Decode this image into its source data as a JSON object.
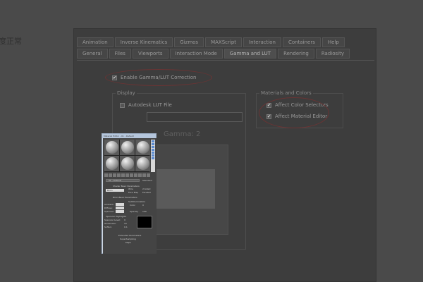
{
  "page": {
    "side_text": "度正常"
  },
  "dialog": {
    "tabs_row1": [
      "Animation",
      "Inverse Kinematics",
      "Gizmos",
      "MAXScript",
      "Interaction",
      "Containers",
      "Help"
    ],
    "tabs_row2": [
      "General",
      "Files",
      "Viewports",
      "Interaction Mode",
      "Gamma and LUT",
      "Rendering",
      "Radiosity"
    ],
    "active_tab": "Gamma and LUT",
    "enable_option": {
      "label": "Enable Gamma/LUT Correction",
      "checked": true
    },
    "display_group": {
      "title": "Display",
      "lut_option": {
        "label": "Autodesk LUT File",
        "checked": false
      },
      "gamma_label": "Gamma: 2"
    },
    "materials_group": {
      "title": "Materials and Colors",
      "options": [
        {
          "label": "Affect Color Selectors",
          "checked": true
        },
        {
          "label": "Affect Material Editor",
          "checked": true
        }
      ]
    },
    "check_glyph": "✔"
  },
  "material_editor": {
    "title": "Material Editor - 01 - Default",
    "sample_slots": 6,
    "material_name": "01 - Default",
    "material_type": "Standard",
    "rollouts": {
      "shader_basic": "Shader Basic Parameters",
      "shader_type": "Blinn",
      "wire": "Wire",
      "two_sided": "2-Sided",
      "face_map": "Face Map",
      "faceted": "Faceted",
      "blinn_basic": "Blinn Basic Parameters",
      "self_illumination": "Self-Illumination",
      "ambient": "Ambient:",
      "diffuse": "Diffuse:",
      "specular": "Specular:",
      "color": "Color",
      "color_value": "0",
      "opacity": "Opacity:",
      "opacity_value": "100",
      "specular_highlights": "Specular Highlights",
      "specular_level": "Specular Level:",
      "specular_level_value": "0",
      "glossiness": "Glossiness:",
      "glossiness_value": "10",
      "soften": "Soften:",
      "soften_value": "0.1",
      "extended": "Extended Parameters",
      "supersampling": "SuperSampling",
      "maps": "Maps"
    }
  }
}
